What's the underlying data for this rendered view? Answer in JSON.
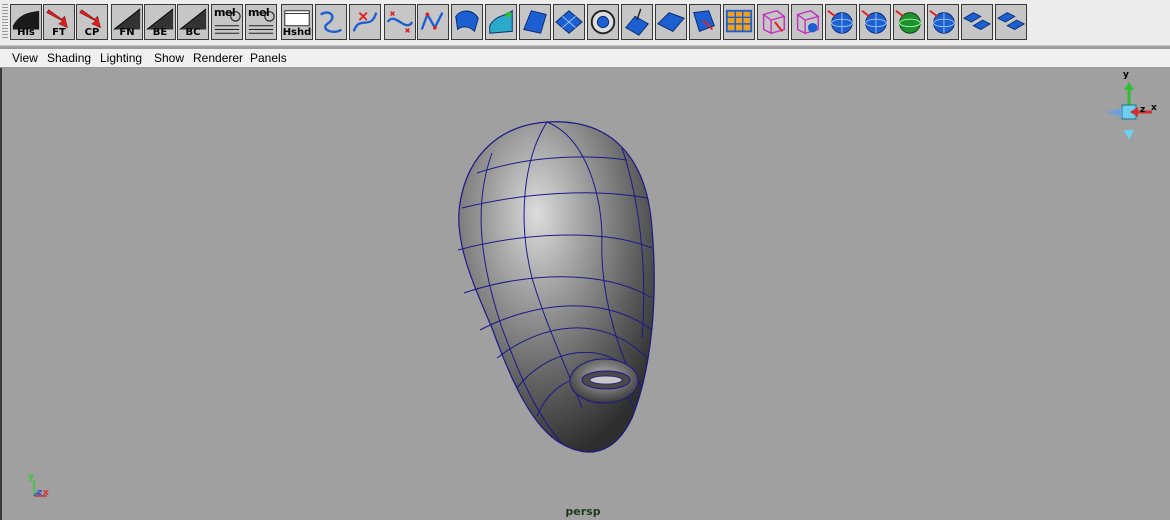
{
  "shelf": {
    "tools": [
      {
        "name": "history-tool",
        "label": "His",
        "icon": "history-curve-icon"
      },
      {
        "name": "freeze-transforms-tool",
        "label": "FT",
        "icon": "red-arrow-icon"
      },
      {
        "name": "center-pivot-tool",
        "label": "CP",
        "icon": "red-arrow-icon"
      },
      {
        "name": "freeze-normals-tool",
        "label": "FN",
        "icon": "diagonal-line-icon"
      },
      {
        "name": "bevel-edge-tool",
        "label": "BE",
        "icon": "diagonal-line-icon"
      },
      {
        "name": "bc-tool",
        "label": "BC",
        "icon": "diagonal-line-icon"
      },
      {
        "name": "mel-script-1-tool",
        "label": "mel",
        "icon": "mel-script-icon"
      },
      {
        "name": "mel-script-2-tool",
        "label": "mel",
        "icon": "mel-script-icon"
      },
      {
        "name": "hypershade-tool",
        "label": "Hshd",
        "icon": "hypershade-window-icon"
      },
      {
        "name": "curve-tool-1",
        "label": "",
        "icon": "curve-icon"
      },
      {
        "name": "curve-tool-2",
        "label": "",
        "icon": "curve-scissors-icon"
      },
      {
        "name": "curve-tool-3",
        "label": "",
        "icon": "curve-edit-icon"
      },
      {
        "name": "curve-tool-4",
        "label": "",
        "icon": "curve-points-icon"
      },
      {
        "name": "surface-tool-1",
        "label": "",
        "icon": "surface-revolve-icon"
      },
      {
        "name": "surface-tool-2",
        "label": "",
        "icon": "surface-loft-icon"
      },
      {
        "name": "surface-tool-3",
        "label": "",
        "icon": "surface-planar-icon"
      },
      {
        "name": "surface-tool-4",
        "label": "",
        "icon": "surface-patch-icon"
      },
      {
        "name": "surface-tool-5",
        "label": "",
        "icon": "surface-circle-icon"
      },
      {
        "name": "surface-tool-6",
        "label": "",
        "icon": "surface-project-icon"
      },
      {
        "name": "surface-tool-7",
        "label": "",
        "icon": "surface-bevel-icon"
      },
      {
        "name": "surface-tool-8",
        "label": "",
        "icon": "surface-trim-icon"
      },
      {
        "name": "surface-tool-9",
        "label": "",
        "icon": "surface-grid-icon"
      },
      {
        "name": "surface-tool-10",
        "label": "",
        "icon": "cube-lattice-icon"
      },
      {
        "name": "surface-tool-11",
        "label": "",
        "icon": "cube-sculpt-icon"
      },
      {
        "name": "sphere-tool-1",
        "label": "",
        "icon": "sphere-icon"
      },
      {
        "name": "sphere-tool-2",
        "label": "",
        "icon": "sphere-icon"
      },
      {
        "name": "sphere-tool-3",
        "label": "",
        "icon": "sphere-green-icon"
      },
      {
        "name": "sphere-tool-4",
        "label": "",
        "icon": "sphere-icon"
      },
      {
        "name": "plane-tool-1",
        "label": "",
        "icon": "plane-stack-icon"
      },
      {
        "name": "plane-tool-2",
        "label": "",
        "icon": "plane-stack-icon"
      }
    ]
  },
  "menubar": {
    "items": [
      "View",
      "Shading",
      "Lighting",
      "Show",
      "Renderer",
      "Panels"
    ]
  },
  "viewport": {
    "camera": "persp",
    "view_cube_axes": {
      "y": "y",
      "z": "z",
      "x": "x"
    },
    "origin_axes": {
      "y": "y",
      "z": "z",
      "x": "x"
    },
    "colors": {
      "background": "#a0a0a0",
      "wireframe": "#1a1a88",
      "camera_label": "#1d3b1d"
    }
  }
}
